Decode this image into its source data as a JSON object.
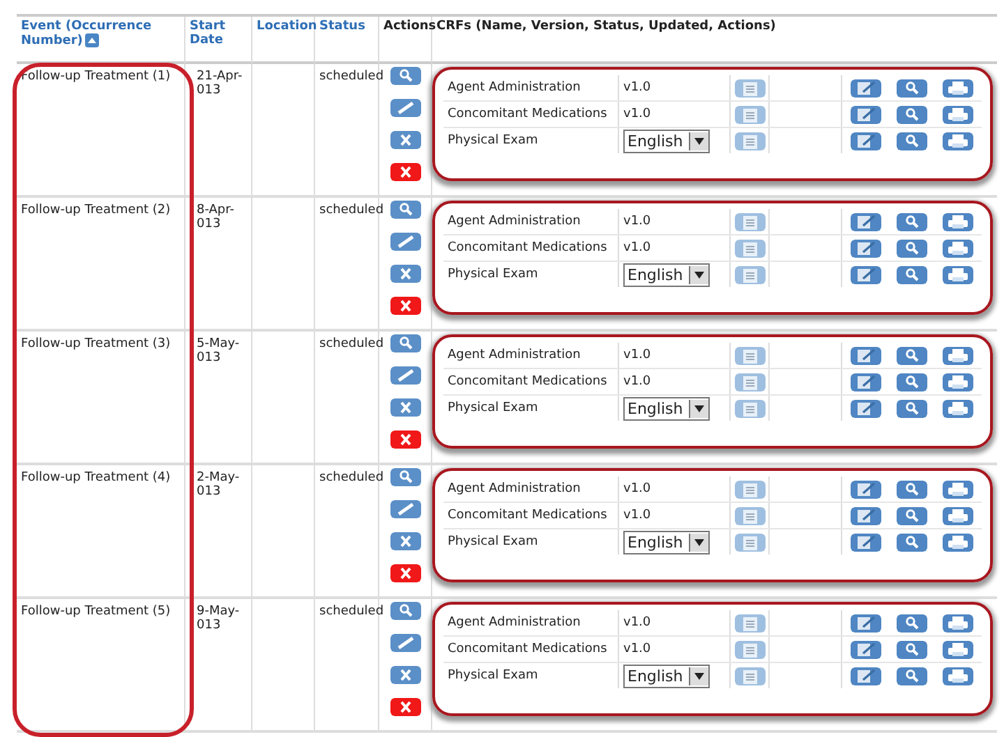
{
  "columns": [
    {
      "label": "Event (Occurrence Number)",
      "link": true,
      "sort_icon": true
    },
    {
      "label": "Start Date",
      "link": true,
      "sort_icon": false
    },
    {
      "label": "Location",
      "link": true,
      "sort_icon": false
    },
    {
      "label": "Status",
      "link": true,
      "sort_icon": false
    },
    {
      "label": "Actions",
      "link": false,
      "sort_icon": false
    },
    {
      "label": "CRFs (Name, Version, Status, Updated, Actions)",
      "link": false,
      "sort_icon": false
    }
  ],
  "rows": [
    {
      "event": "Follow-up Treatment (1)",
      "start_date": [
        "21-Apr-",
        "013"
      ],
      "status": "scheduled",
      "crfs": [
        {
          "name": "Agent Administration",
          "kind": "text",
          "version": "v1.0"
        },
        {
          "name": "Concomitant Medications",
          "kind": "text",
          "version": "v1.0"
        },
        {
          "name": "Physical Exam",
          "kind": "select",
          "version": "English"
        }
      ]
    },
    {
      "event": "Follow-up Treatment (2)",
      "start_date": [
        "8-Apr-",
        "013"
      ],
      "status": "scheduled",
      "crfs": [
        {
          "name": "Agent Administration",
          "kind": "text",
          "version": "v1.0"
        },
        {
          "name": "Concomitant Medications",
          "kind": "text",
          "version": "v1.0"
        },
        {
          "name": "Physical Exam",
          "kind": "select",
          "version": "English"
        }
      ]
    },
    {
      "event": "Follow-up Treatment (3)",
      "start_date": [
        "5-May-",
        "013"
      ],
      "status": "scheduled",
      "crfs": [
        {
          "name": "Agent Administration",
          "kind": "text",
          "version": "v1.0"
        },
        {
          "name": "Concomitant Medications",
          "kind": "text",
          "version": "v1.0"
        },
        {
          "name": "Physical Exam",
          "kind": "select",
          "version": "English"
        }
      ]
    },
    {
      "event": "Follow-up Treatment (4)",
      "start_date": [
        "2-May-",
        "013"
      ],
      "status": "scheduled",
      "crfs": [
        {
          "name": "Agent Administration",
          "kind": "text",
          "version": "v1.0"
        },
        {
          "name": "Concomitant Medications",
          "kind": "text",
          "version": "v1.0"
        },
        {
          "name": "Physical Exam",
          "kind": "select",
          "version": "English"
        }
      ]
    },
    {
      "event": "Follow-up Treatment (5)",
      "start_date": [
        "9-May-",
        "013"
      ],
      "status": "scheduled",
      "crfs": [
        {
          "name": "Agent Administration",
          "kind": "text",
          "version": "v1.0"
        },
        {
          "name": "Concomitant Medications",
          "kind": "text",
          "version": "v1.0"
        },
        {
          "name": "Physical Exam",
          "kind": "select",
          "version": "English"
        }
      ]
    }
  ]
}
